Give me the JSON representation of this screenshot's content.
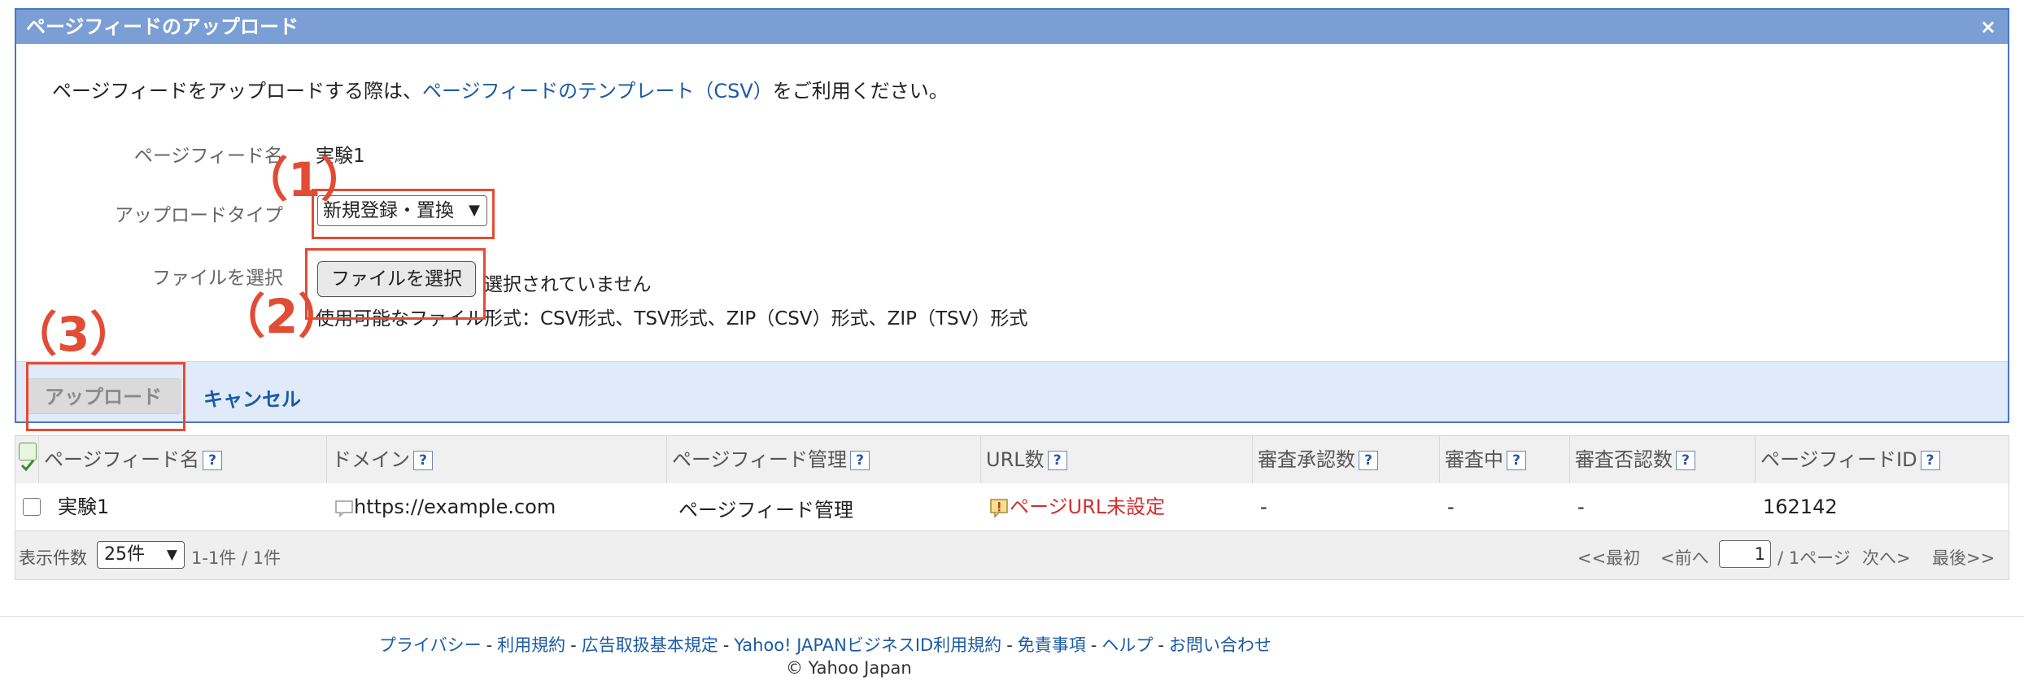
{
  "dialog": {
    "title": "ページフィードのアップロード",
    "close_icon": "×",
    "intro_prefix": "ページフィードをアップロードする際は、",
    "intro_link": "ページフィードのテンプレート（CSV）",
    "intro_suffix": "をご利用ください。",
    "fields": {
      "feed_name_label": "ページフィード名",
      "feed_name_value": "実験1",
      "upload_type_label": "アップロードタイプ",
      "upload_type_value": "新規登録・置換",
      "file_label": "ファイルを選択",
      "file_button": "ファイルを選択",
      "file_none": "選択されていません",
      "file_formats": "使用可能なファイル形式：CSV形式、TSV形式、ZIP（CSV）形式、ZIP（TSV）形式"
    },
    "upload_button": "アップロード",
    "cancel_link": "キャンセル"
  },
  "annotations": [
    "（1）",
    "（2）",
    "（3）"
  ],
  "annotation_color": "#e24b34",
  "table": {
    "help_glyph": "?",
    "columns": [
      "ページフィード名",
      "ドメイン",
      "ページフィード管理",
      "URL数",
      "審査承認数",
      "審査中",
      "審査否認数",
      "ページフィードID"
    ],
    "rows": [
      {
        "name": "実験1",
        "domain": "https://example.com",
        "manage": "ページフィード管理",
        "url_count": "ページURL未設定",
        "approved": "-",
        "pending": "-",
        "rejected": "-",
        "id": "162142"
      }
    ],
    "footer": {
      "per_page_label": "表示件数",
      "per_page_value": "25件",
      "range": "1-1件 / 1件",
      "first": "<<最初",
      "prev": "<前へ",
      "page": "1",
      "pages": "/ 1ページ",
      "next": "次へ>",
      "last": "最後>>"
    }
  },
  "footer": {
    "links": [
      "プライバシー",
      "利用規約",
      "広告取扱基本規定",
      "Yahoo! JAPANビジネスID利用規約",
      "免責事項",
      "ヘルプ",
      "お問い合わせ"
    ],
    "separator": "-",
    "copyright": "© Yahoo Japan"
  },
  "colors": {
    "header_bg": "#7b9fd5",
    "dialog_border": "#4a77c4",
    "footer_bg": "#e0eaf8",
    "link": "#1a5aa6",
    "warning_text": "#d32f2f"
  }
}
